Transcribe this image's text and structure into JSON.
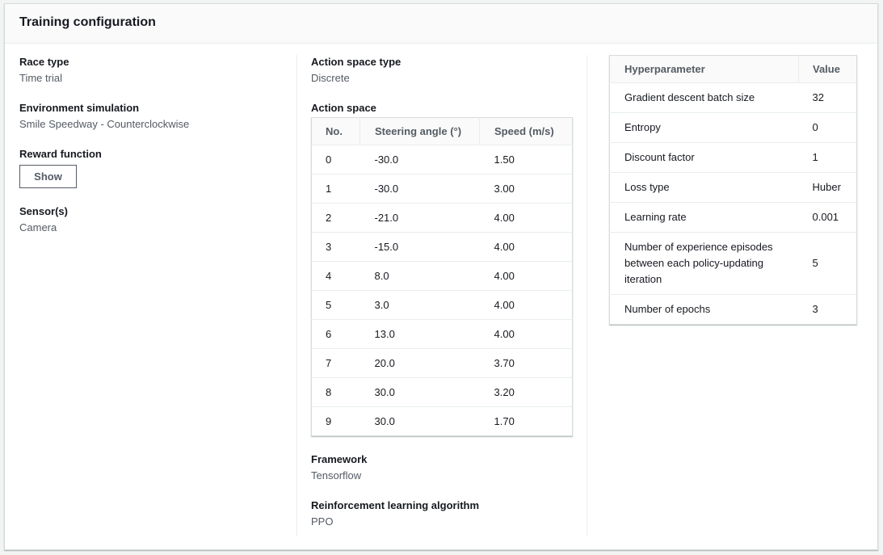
{
  "panel": {
    "title": "Training configuration"
  },
  "left": {
    "race_type": {
      "label": "Race type",
      "value": "Time trial"
    },
    "environment": {
      "label": "Environment simulation",
      "value": "Smile Speedway - Counterclockwise"
    },
    "reward": {
      "label": "Reward function",
      "button": "Show"
    },
    "sensors": {
      "label": "Sensor(s)",
      "value": "Camera"
    }
  },
  "middle": {
    "action_space_type": {
      "label": "Action space type",
      "value": "Discrete"
    },
    "action_space": {
      "label": "Action space",
      "headers": [
        "No.",
        "Steering angle (°)",
        "Speed (m/s)"
      ],
      "rows": [
        [
          "0",
          "-30.0",
          "1.50"
        ],
        [
          "1",
          "-30.0",
          "3.00"
        ],
        [
          "2",
          "-21.0",
          "4.00"
        ],
        [
          "3",
          "-15.0",
          "4.00"
        ],
        [
          "4",
          "8.0",
          "4.00"
        ],
        [
          "5",
          "3.0",
          "4.00"
        ],
        [
          "6",
          "13.0",
          "4.00"
        ],
        [
          "7",
          "20.0",
          "3.70"
        ],
        [
          "8",
          "30.0",
          "3.20"
        ],
        [
          "9",
          "30.0",
          "1.70"
        ]
      ]
    },
    "framework": {
      "label": "Framework",
      "value": "Tensorflow"
    },
    "algorithm": {
      "label": "Reinforcement learning algorithm",
      "value": "PPO"
    }
  },
  "hyperparameters": {
    "headers": [
      "Hyperparameter",
      "Value"
    ],
    "rows": [
      [
        "Gradient descent batch size",
        "32"
      ],
      [
        "Entropy",
        "0"
      ],
      [
        "Discount factor",
        "1"
      ],
      [
        "Loss type",
        "Huber"
      ],
      [
        "Learning rate",
        "0.001"
      ],
      [
        "Number of experience episodes between each policy-updating iteration",
        "5"
      ],
      [
        "Number of epochs",
        "3"
      ]
    ]
  }
}
